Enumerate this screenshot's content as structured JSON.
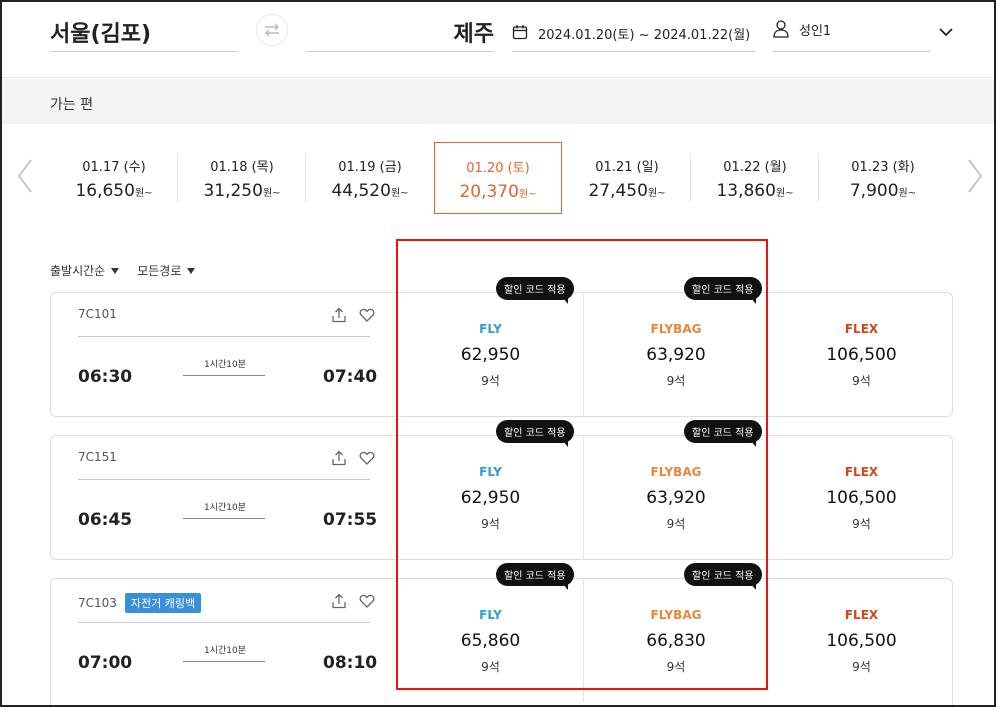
{
  "search": {
    "origin": "서울(김포)",
    "destination": "제주",
    "dates": "2024.01.20(토) ~ 2024.01.22(월)",
    "passengers": "성인1"
  },
  "section_title": "가는 편",
  "date_strip": [
    {
      "date": "01.17 (수)",
      "price": "16,650",
      "unit": "원~",
      "active": false
    },
    {
      "date": "01.18 (목)",
      "price": "31,250",
      "unit": "원~",
      "active": false
    },
    {
      "date": "01.19 (금)",
      "price": "44,520",
      "unit": "원~",
      "active": false
    },
    {
      "date": "01.20 (토)",
      "price": "20,370",
      "unit": "원~",
      "active": true
    },
    {
      "date": "01.21 (일)",
      "price": "27,450",
      "unit": "원~",
      "active": false
    },
    {
      "date": "01.22 (월)",
      "price": "13,860",
      "unit": "원~",
      "active": false
    },
    {
      "date": "01.23 (화)",
      "price": "7,900",
      "unit": "원~",
      "active": false
    }
  ],
  "filters": {
    "sort": "출발시간순",
    "route": "모든경로"
  },
  "badge_text": "할인 코드 적용",
  "flights": [
    {
      "flight_no": "7C101",
      "tag": "",
      "depart": "06:30",
      "arrive": "07:40",
      "duration": "1시간10분",
      "fares": [
        {
          "class": "FLY",
          "price": "62,950",
          "seats": "9석"
        },
        {
          "class": "FLYBAG",
          "price": "63,920",
          "seats": "9석"
        },
        {
          "class": "FLEX",
          "price": "106,500",
          "seats": "9석"
        }
      ]
    },
    {
      "flight_no": "7C151",
      "tag": "",
      "depart": "06:45",
      "arrive": "07:55",
      "duration": "1시간10분",
      "fares": [
        {
          "class": "FLY",
          "price": "62,950",
          "seats": "9석"
        },
        {
          "class": "FLYBAG",
          "price": "63,920",
          "seats": "9석"
        },
        {
          "class": "FLEX",
          "price": "106,500",
          "seats": "9석"
        }
      ]
    },
    {
      "flight_no": "7C103",
      "tag": "자전거 캐링백",
      "depart": "07:00",
      "arrive": "08:10",
      "duration": "1시간10분",
      "fares": [
        {
          "class": "FLY",
          "price": "65,860",
          "seats": "9석"
        },
        {
          "class": "FLYBAG",
          "price": "66,830",
          "seats": "9석"
        },
        {
          "class": "FLEX",
          "price": "106,500",
          "seats": "9석"
        }
      ]
    }
  ],
  "colors": {
    "accent": "#e0652b",
    "fly": "#2e9ed4",
    "flybag": "#e8863a",
    "flex": "#d8441c",
    "highlight": "#e11111"
  }
}
